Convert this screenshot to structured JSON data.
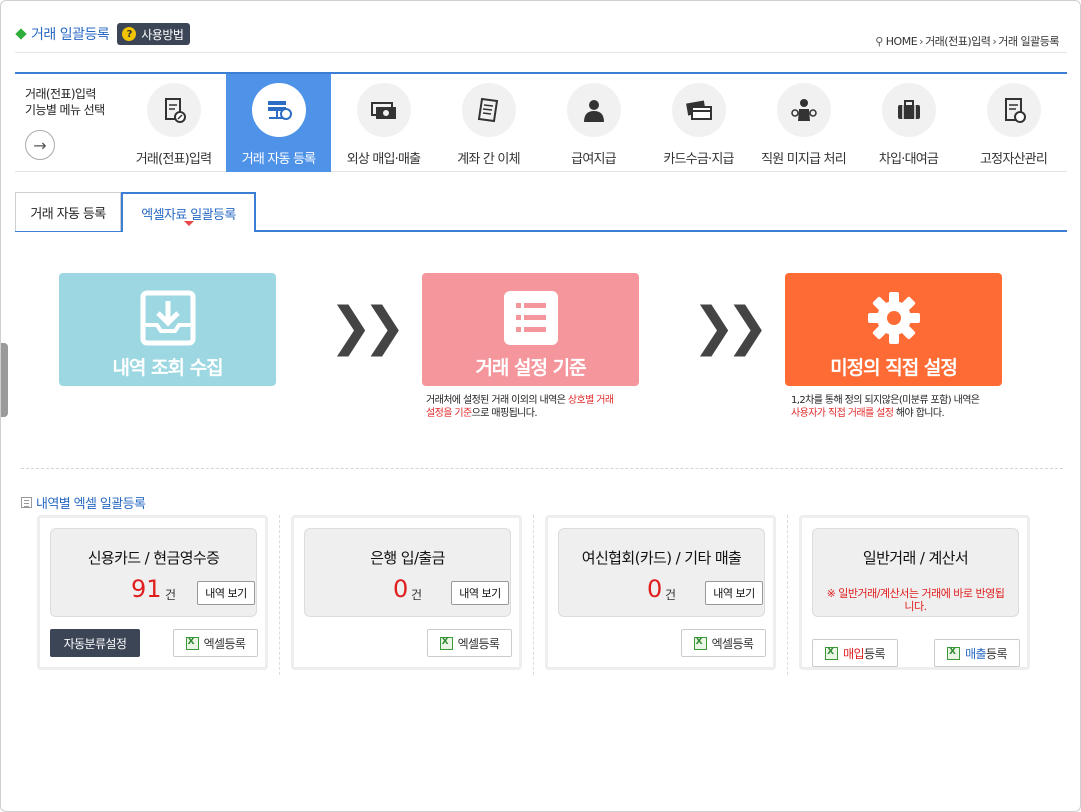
{
  "header": {
    "title": "거래 일괄등록",
    "help_label": "사용방법",
    "breadcrumb": [
      "HOME",
      "거래(전표)입력",
      "거래 일괄등록"
    ]
  },
  "menu": {
    "label_line1": "거래(전표)입력",
    "label_line2": "기능별 메뉴 선택",
    "items": [
      {
        "label": "거래(전표)입력",
        "icon": "document-edit-icon"
      },
      {
        "label": "거래 자동 등록",
        "icon": "server-sync-icon",
        "active": true
      },
      {
        "label": "외상 매입·매출",
        "icon": "money-icon"
      },
      {
        "label": "계좌 간 이체",
        "icon": "receipt-icon"
      },
      {
        "label": "급여지급",
        "icon": "person-icon"
      },
      {
        "label": "카드수금·지급",
        "icon": "cards-icon"
      },
      {
        "label": "직원 미지급 처리",
        "icon": "employee-money-icon"
      },
      {
        "label": "차입·대여금",
        "icon": "briefcase-icon"
      },
      {
        "label": "고정자산관리",
        "icon": "asset-document-icon"
      }
    ]
  },
  "tabs": [
    {
      "label": "거래 자동 등록"
    },
    {
      "label": "엑셀자료 일괄등록",
      "active": true
    }
  ],
  "process": {
    "step1": "내역 조회 수집",
    "step2": "거래 설정 기준",
    "step3": "미정의 직접 설정",
    "desc2_a": "거래처에 설정된 거래 이외의 내역은 ",
    "desc2_b": "상호별 거래",
    "desc2_c": "설정을 기준",
    "desc2_d": "으로 매핑됩니다.",
    "desc3_a": "1,2차를 통해 정의 되지않은(미분류 포함) 내역은",
    "desc3_b": "사용자가 직접 거래를 설정",
    "desc3_c": " 해야 합니다."
  },
  "section_title": "내역별 엑셀 일괄등록",
  "cards": {
    "card1": {
      "title": "신용카드 / 현금영수증",
      "count": "91",
      "unit": "건",
      "view": "내역 보기",
      "auto": "자동분류설정",
      "excel": "엑셀등록"
    },
    "card2": {
      "title": "은행 입/출금",
      "count": "0",
      "unit": "건",
      "view": "내역 보기",
      "excel": "엑셀등록"
    },
    "card3": {
      "title": "여신협회(카드) / 기타 매출",
      "count": "0",
      "unit": "건",
      "view": "내역 보기",
      "excel": "엑셀등록"
    },
    "card4": {
      "title": "일반거래 / 계산서",
      "notice": "※ 일반거래/계산서는 거래에 바로 반영됩니다.",
      "buy_a": "매입",
      "buy_b": "등록",
      "sell_a": "매출",
      "sell_b": "등록"
    }
  },
  "colors": {
    "accent": "#3a7fd5",
    "active_menu": "#4f93e9",
    "step1": "#9dd8e2",
    "step2": "#f4969c",
    "step3": "#ff6b35",
    "count_red": "#e01e1e"
  }
}
